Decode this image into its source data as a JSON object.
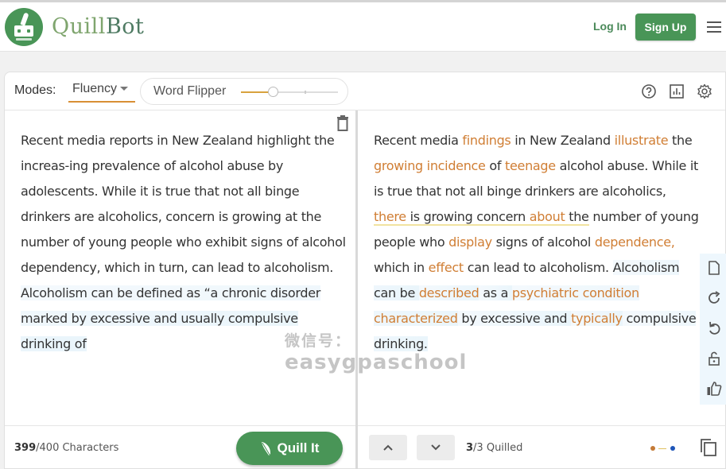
{
  "header": {
    "brand_part1": "Quill",
    "brand_part2": "Bot",
    "login_label": "Log In",
    "signup_label": "Sign Up",
    "menu_icon": "hamburger-menu-icon"
  },
  "toolbar": {
    "modes_label": "Modes:",
    "selected_mode": "Fluency",
    "word_flipper_label": "Word Flipper",
    "word_flipper_level": 0.33,
    "icons": [
      "help-icon",
      "stats-icon",
      "settings-icon"
    ]
  },
  "input": {
    "sentences": [
      {
        "text": "Recent media reports in New Zealand highlight the increas-ing prevalence of alcohol abuse by adolescents. While it is true that not all binge drinkers are alcoholics, concern is growing at the number of young people who exhibit signs of alcohol dependency, which in turn, can lead to alcoholism. ",
        "highlighted": false
      },
      {
        "text": "Alcoholism can be defined as “a chronic disorder marked by excessive and usually compulsive drinking of",
        "highlighted": true
      }
    ],
    "char_count_current": "399",
    "char_count_suffix": "/400 Characters",
    "quill_button_label": "Quill It"
  },
  "output": {
    "segments": [
      {
        "t": "Recent media ",
        "c": false
      },
      {
        "t": "findings",
        "c": true
      },
      {
        "t": " in New Zealand ",
        "c": false
      },
      {
        "t": "illustrate",
        "c": true
      },
      {
        "t": " the ",
        "c": false
      },
      {
        "t": "growing incidence",
        "c": true
      },
      {
        "t": " of ",
        "c": false
      },
      {
        "t": "teenage",
        "c": true
      },
      {
        "t": " alcohol abuse. While it is true that not all binge drinkers are alcoholics, ",
        "c": false
      },
      {
        "t": "there",
        "c": true,
        "s": true
      },
      {
        "t": " is growing concern ",
        "c": false,
        "s": true
      },
      {
        "t": "about",
        "c": true,
        "s": true
      },
      {
        "t": " the",
        "c": false,
        "s": true
      },
      {
        "t": " number of young people who ",
        "c": false
      },
      {
        "t": "display",
        "c": true
      },
      {
        "t": " signs of alcohol ",
        "c": false
      },
      {
        "t": "dependence,",
        "c": true
      },
      {
        "t": " which in ",
        "c": false
      },
      {
        "t": "effect",
        "c": true
      },
      {
        "t": " can lead to alcoholism. ",
        "c": false
      },
      {
        "t": "Alcoholism can be ",
        "c": false,
        "h": true
      },
      {
        "t": "described",
        "c": true,
        "h": true
      },
      {
        "t": " as a ",
        "c": false,
        "h": true
      },
      {
        "t": "psychiatric condition characterized",
        "c": true,
        "h": true
      },
      {
        "t": " by excessive and ",
        "c": false,
        "h": true
      },
      {
        "t": "typically",
        "c": true,
        "h": true
      },
      {
        "t": " compulsive drinking.",
        "c": false,
        "h": true
      }
    ],
    "quilled_current": "3",
    "quilled_suffix": "/3 Quilled",
    "side_tools": [
      "document-icon",
      "redo-icon",
      "undo-icon",
      "unlock-icon",
      "thumbs-up-icon"
    ],
    "legend_colors": {
      "changed_words": "#c47a36",
      "structural": "#e0c060",
      "longest_unchanged": "#1e55b8"
    }
  },
  "watermark": {
    "line1": "微信号：",
    "line2": "easygpaschool"
  },
  "colors": {
    "brand_green": "#499557",
    "change_orange": "#d07e34",
    "slider_gold": "#d8a23e"
  }
}
